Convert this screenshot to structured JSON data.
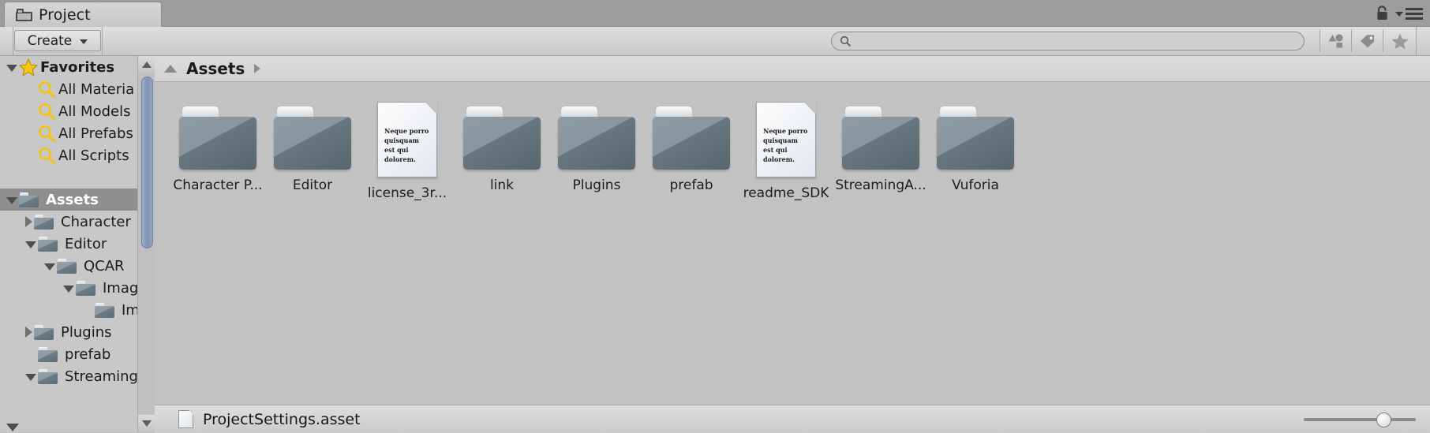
{
  "window": {
    "tab_label": "Project",
    "tab_icon": "folder-icon",
    "lock_icon": "lock-icon",
    "menu_icon": "hamburger-menu-icon"
  },
  "toolbar": {
    "create_label": "Create",
    "create_caret_icon": "chevron-down-icon",
    "search": {
      "value": "",
      "placeholder": "",
      "icon": "search-icon"
    },
    "filter_buttons": [
      {
        "name": "filter-by-type-button",
        "icon": "shapes-icon"
      },
      {
        "name": "filter-by-label-button",
        "icon": "tag-icon"
      },
      {
        "name": "filter-favorites-button",
        "icon": "star-icon"
      }
    ]
  },
  "tree": {
    "scrollbar": {
      "up_arrow_icon": "triangle-up-icon",
      "down_arrow_icon": "triangle-down-icon"
    },
    "items": [
      {
        "label": "Favorites",
        "indent": 0,
        "twisty": "down",
        "icon": "star-icon",
        "selected": false
      },
      {
        "label": "All Materia",
        "indent": 1,
        "twisty": "none",
        "icon": "search-icon",
        "selected": false
      },
      {
        "label": "All Models",
        "indent": 1,
        "twisty": "none",
        "icon": "search-icon",
        "selected": false
      },
      {
        "label": "All Prefabs",
        "indent": 1,
        "twisty": "none",
        "icon": "search-icon",
        "selected": false
      },
      {
        "label": "All Scripts",
        "indent": 1,
        "twisty": "none",
        "icon": "search-icon",
        "selected": false
      },
      {
        "label": "",
        "indent": 0,
        "twisty": "none",
        "icon": "none",
        "selected": false
      },
      {
        "label": "Assets",
        "indent": 0,
        "twisty": "down",
        "icon": "folder-icon",
        "selected": true
      },
      {
        "label": "Character",
        "indent": 1,
        "twisty": "right",
        "icon": "folder-icon",
        "selected": false
      },
      {
        "label": "Editor",
        "indent": 1,
        "twisty": "down",
        "icon": "folder-icon",
        "selected": false
      },
      {
        "label": "QCAR",
        "indent": 2,
        "twisty": "down",
        "icon": "folder-icon",
        "selected": false
      },
      {
        "label": "Imag",
        "indent": 3,
        "twisty": "down",
        "icon": "folder-icon",
        "selected": false
      },
      {
        "label": "Im",
        "indent": 4,
        "twisty": "none",
        "icon": "folder-icon",
        "selected": false
      },
      {
        "label": "Plugins",
        "indent": 1,
        "twisty": "right",
        "icon": "folder-icon",
        "selected": false
      },
      {
        "label": "prefab",
        "indent": 1,
        "twisty": "none",
        "icon": "folder-icon",
        "selected": false
      },
      {
        "label": "Streaming",
        "indent": 1,
        "twisty": "down",
        "icon": "folder-icon",
        "selected": false
      }
    ]
  },
  "breadcrumb": {
    "path": "Assets",
    "arrow_icon": "chevron-right-icon",
    "collapse_icon": "triangle-up-icon"
  },
  "grid": {
    "doc_preview_text": "Neque porro quisquam est qui dolorem.",
    "items": [
      {
        "label": "Character P...",
        "type": "folder"
      },
      {
        "label": "Editor",
        "type": "folder"
      },
      {
        "label": "license_3r...",
        "type": "document"
      },
      {
        "label": "link",
        "type": "folder"
      },
      {
        "label": "Plugins",
        "type": "folder"
      },
      {
        "label": "prefab",
        "type": "folder"
      },
      {
        "label": "readme_SDK",
        "type": "document"
      },
      {
        "label": "StreamingA...",
        "type": "folder"
      },
      {
        "label": "Vuforia",
        "type": "folder"
      }
    ]
  },
  "statusbar": {
    "selected_asset": "ProjectSettings.asset",
    "asset_icon": "document-icon",
    "zoom_slider": {
      "value": 65,
      "min": 0,
      "max": 100
    }
  },
  "colors": {
    "panel_bg": "#c2c2c2",
    "titlebar_bg": "#9d9d9d",
    "selection_bg": "#8f8f8f",
    "folder_icon": "#6d7c84",
    "scrollbar_thumb": "#7e93b6",
    "favorite_star": "#f5c518"
  }
}
